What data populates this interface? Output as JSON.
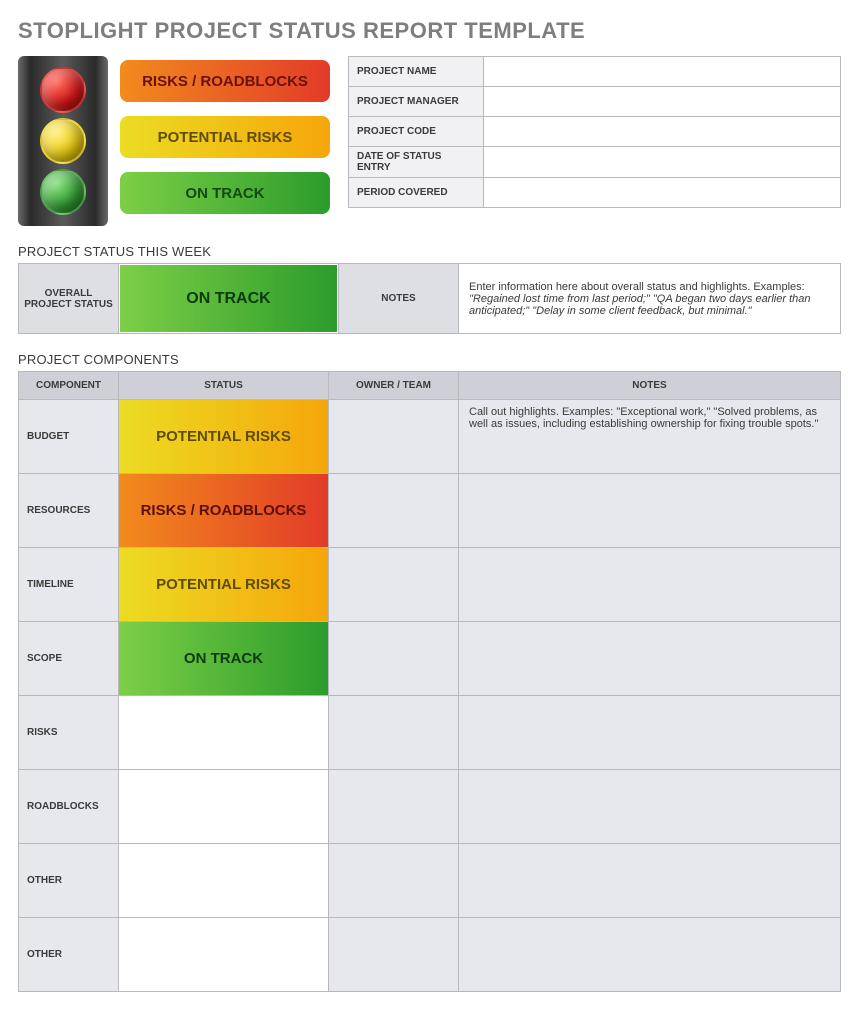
{
  "title": "STOPLIGHT PROJECT STATUS REPORT TEMPLATE",
  "legend": {
    "red": "RISKS / ROADBLOCKS",
    "yellow": "POTENTIAL RISKS",
    "green": "ON TRACK"
  },
  "meta": {
    "fields": [
      {
        "label": "PROJECT NAME",
        "value": ""
      },
      {
        "label": "PROJECT MANAGER",
        "value": ""
      },
      {
        "label": "PROJECT CODE",
        "value": ""
      },
      {
        "label": "DATE OF STATUS ENTRY",
        "value": ""
      },
      {
        "label": "PERIOD COVERED",
        "value": ""
      }
    ]
  },
  "status_week": {
    "heading": "PROJECT STATUS THIS WEEK",
    "overall_label": "OVERALL PROJECT STATUS",
    "overall_status": "ON TRACK",
    "overall_status_class": "st-green",
    "notes_label": "NOTES",
    "notes_intro": "Enter information here about overall status and highlights. Examples: ",
    "notes_examples": "\"Regained lost time from last period;\" \"QA began two days earlier than anticipated;\" \"Delay in some client feedback, but minimal.\""
  },
  "components": {
    "heading": "PROJECT COMPONENTS",
    "headers": {
      "c1": "COMPONENT",
      "c2": "STATUS",
      "c3": "OWNER / TEAM",
      "c4": "NOTES"
    },
    "rows": [
      {
        "name": "BUDGET",
        "status": "POTENTIAL RISKS",
        "class": "st-yellow",
        "owner": "",
        "notes": "Call out highlights. Examples: \"Exceptional work,\" \"Solved problems, as well as issues, including establishing ownership for fixing trouble spots.\""
      },
      {
        "name": "RESOURCES",
        "status": "RISKS / ROADBLOCKS",
        "class": "st-red",
        "owner": "",
        "notes": ""
      },
      {
        "name": "TIMELINE",
        "status": "POTENTIAL RISKS",
        "class": "st-yellow",
        "owner": "",
        "notes": ""
      },
      {
        "name": "SCOPE",
        "status": "ON TRACK",
        "class": "st-green",
        "owner": "",
        "notes": ""
      },
      {
        "name": "RISKS",
        "status": "",
        "class": "",
        "owner": "",
        "notes": ""
      },
      {
        "name": "ROADBLOCKS",
        "status": "",
        "class": "",
        "owner": "",
        "notes": ""
      },
      {
        "name": "OTHER",
        "status": "",
        "class": "",
        "owner": "",
        "notes": ""
      },
      {
        "name": "OTHER",
        "status": "",
        "class": "",
        "owner": "",
        "notes": ""
      }
    ]
  }
}
